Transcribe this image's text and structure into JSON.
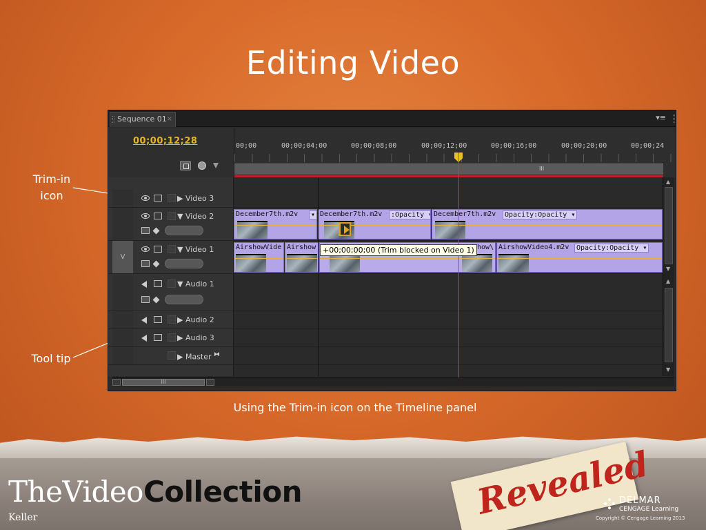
{
  "slide": {
    "title": "Editing Video",
    "caption": "Using the Trim-in icon on the Timeline panel",
    "callouts": {
      "trim_in_line1": "Trim-in",
      "trim_in_line2": "icon",
      "tool_tip": "Tool tip"
    },
    "colors": {
      "background": "#d8692a",
      "text": "#ffffff"
    }
  },
  "panel": {
    "tab_label": "Sequence 01",
    "tab_close": "×",
    "menu_glyph": "▾≡",
    "timecode": "00;00;12;28",
    "ruler_labels": [
      "00;00",
      "00;00;04;00",
      "00;00;08;00",
      "00;00;12;00",
      "00;00;16;00",
      "00;00;20;00",
      "00;00;24"
    ],
    "work_area_grip": "III",
    "hscroll_grip": "III",
    "colors": {
      "timecode": "#e7b521",
      "clip": "#b3a3e7",
      "playhead": "#d43a3a",
      "trim_icon": "#e0a020"
    }
  },
  "tracks": {
    "video3": {
      "name": "Video 3",
      "expander": "▶"
    },
    "video2": {
      "name": "Video 2",
      "expander": "▼"
    },
    "video1": {
      "name": "Video 1",
      "expander": "▼",
      "target_label": "V"
    },
    "audio1": {
      "name": "Audio 1",
      "expander": "▼"
    },
    "audio2": {
      "name": "Audio 2",
      "expander": "▶"
    },
    "audio3": {
      "name": "Audio 3",
      "expander": "▶"
    },
    "master": {
      "name": "Master",
      "expander": "▶",
      "extra": "⧓"
    }
  },
  "clips": {
    "video2": [
      {
        "label": "December7th.m2v",
        "dropdown": "▾"
      },
      {
        "label": "December7th.m2v",
        "opacity": ":Opacity ▾"
      },
      {
        "label": "December7th.m2v",
        "opacity": "Opacity:Opacity ▾"
      }
    ],
    "video1": [
      {
        "label": "AirshowVide"
      },
      {
        "label": "Airshow"
      },
      {
        "label": "show\\"
      },
      {
        "label": "AirshowVideo4.m2v",
        "opacity": "Opacity:Opacity ▾"
      }
    ]
  },
  "tooltip": "+00;00;00;00 (Trim blocked on Video 1)",
  "footer": {
    "brand_light": "TheVideo",
    "brand_bold": "Collection",
    "author": "Keller",
    "revealed": "Revealed",
    "publisher_name": "DELMAR",
    "publisher_sub": "CENGAGE Learning",
    "copyright": "Copyright © Cengage Learning 2013"
  }
}
